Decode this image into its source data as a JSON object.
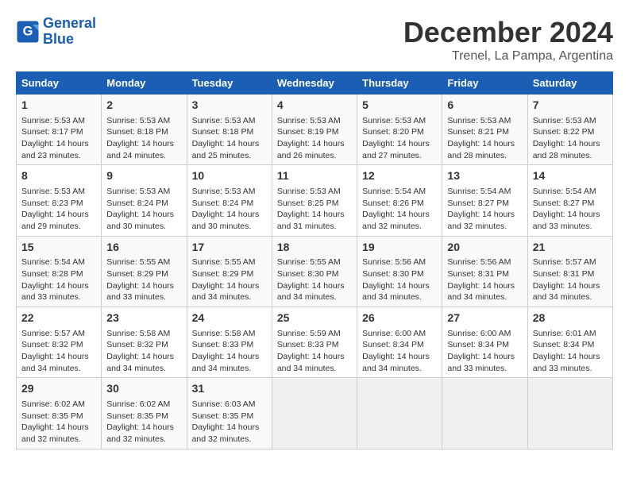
{
  "logo": {
    "line1": "General",
    "line2": "Blue"
  },
  "title": "December 2024",
  "location": "Trenel, La Pampa, Argentina",
  "days_of_week": [
    "Sunday",
    "Monday",
    "Tuesday",
    "Wednesday",
    "Thursday",
    "Friday",
    "Saturday"
  ],
  "weeks": [
    [
      {
        "day": 1,
        "info": "Sunrise: 5:53 AM\nSunset: 8:17 PM\nDaylight: 14 hours\nand 23 minutes."
      },
      {
        "day": 2,
        "info": "Sunrise: 5:53 AM\nSunset: 8:18 PM\nDaylight: 14 hours\nand 24 minutes."
      },
      {
        "day": 3,
        "info": "Sunrise: 5:53 AM\nSunset: 8:18 PM\nDaylight: 14 hours\nand 25 minutes."
      },
      {
        "day": 4,
        "info": "Sunrise: 5:53 AM\nSunset: 8:19 PM\nDaylight: 14 hours\nand 26 minutes."
      },
      {
        "day": 5,
        "info": "Sunrise: 5:53 AM\nSunset: 8:20 PM\nDaylight: 14 hours\nand 27 minutes."
      },
      {
        "day": 6,
        "info": "Sunrise: 5:53 AM\nSunset: 8:21 PM\nDaylight: 14 hours\nand 28 minutes."
      },
      {
        "day": 7,
        "info": "Sunrise: 5:53 AM\nSunset: 8:22 PM\nDaylight: 14 hours\nand 28 minutes."
      }
    ],
    [
      {
        "day": 8,
        "info": "Sunrise: 5:53 AM\nSunset: 8:23 PM\nDaylight: 14 hours\nand 29 minutes."
      },
      {
        "day": 9,
        "info": "Sunrise: 5:53 AM\nSunset: 8:24 PM\nDaylight: 14 hours\nand 30 minutes."
      },
      {
        "day": 10,
        "info": "Sunrise: 5:53 AM\nSunset: 8:24 PM\nDaylight: 14 hours\nand 30 minutes."
      },
      {
        "day": 11,
        "info": "Sunrise: 5:53 AM\nSunset: 8:25 PM\nDaylight: 14 hours\nand 31 minutes."
      },
      {
        "day": 12,
        "info": "Sunrise: 5:54 AM\nSunset: 8:26 PM\nDaylight: 14 hours\nand 32 minutes."
      },
      {
        "day": 13,
        "info": "Sunrise: 5:54 AM\nSunset: 8:27 PM\nDaylight: 14 hours\nand 32 minutes."
      },
      {
        "day": 14,
        "info": "Sunrise: 5:54 AM\nSunset: 8:27 PM\nDaylight: 14 hours\nand 33 minutes."
      }
    ],
    [
      {
        "day": 15,
        "info": "Sunrise: 5:54 AM\nSunset: 8:28 PM\nDaylight: 14 hours\nand 33 minutes."
      },
      {
        "day": 16,
        "info": "Sunrise: 5:55 AM\nSunset: 8:29 PM\nDaylight: 14 hours\nand 33 minutes."
      },
      {
        "day": 17,
        "info": "Sunrise: 5:55 AM\nSunset: 8:29 PM\nDaylight: 14 hours\nand 34 minutes."
      },
      {
        "day": 18,
        "info": "Sunrise: 5:55 AM\nSunset: 8:30 PM\nDaylight: 14 hours\nand 34 minutes."
      },
      {
        "day": 19,
        "info": "Sunrise: 5:56 AM\nSunset: 8:30 PM\nDaylight: 14 hours\nand 34 minutes."
      },
      {
        "day": 20,
        "info": "Sunrise: 5:56 AM\nSunset: 8:31 PM\nDaylight: 14 hours\nand 34 minutes."
      },
      {
        "day": 21,
        "info": "Sunrise: 5:57 AM\nSunset: 8:31 PM\nDaylight: 14 hours\nand 34 minutes."
      }
    ],
    [
      {
        "day": 22,
        "info": "Sunrise: 5:57 AM\nSunset: 8:32 PM\nDaylight: 14 hours\nand 34 minutes."
      },
      {
        "day": 23,
        "info": "Sunrise: 5:58 AM\nSunset: 8:32 PM\nDaylight: 14 hours\nand 34 minutes."
      },
      {
        "day": 24,
        "info": "Sunrise: 5:58 AM\nSunset: 8:33 PM\nDaylight: 14 hours\nand 34 minutes."
      },
      {
        "day": 25,
        "info": "Sunrise: 5:59 AM\nSunset: 8:33 PM\nDaylight: 14 hours\nand 34 minutes."
      },
      {
        "day": 26,
        "info": "Sunrise: 6:00 AM\nSunset: 8:34 PM\nDaylight: 14 hours\nand 34 minutes."
      },
      {
        "day": 27,
        "info": "Sunrise: 6:00 AM\nSunset: 8:34 PM\nDaylight: 14 hours\nand 33 minutes."
      },
      {
        "day": 28,
        "info": "Sunrise: 6:01 AM\nSunset: 8:34 PM\nDaylight: 14 hours\nand 33 minutes."
      }
    ],
    [
      {
        "day": 29,
        "info": "Sunrise: 6:02 AM\nSunset: 8:35 PM\nDaylight: 14 hours\nand 32 minutes."
      },
      {
        "day": 30,
        "info": "Sunrise: 6:02 AM\nSunset: 8:35 PM\nDaylight: 14 hours\nand 32 minutes."
      },
      {
        "day": 31,
        "info": "Sunrise: 6:03 AM\nSunset: 8:35 PM\nDaylight: 14 hours\nand 32 minutes."
      },
      null,
      null,
      null,
      null
    ]
  ]
}
